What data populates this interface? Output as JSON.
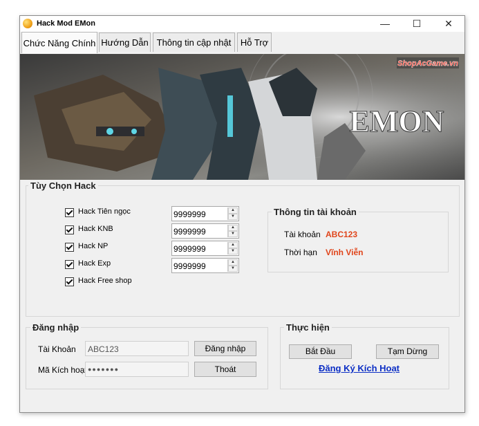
{
  "window": {
    "title": "Hack Mod EMon",
    "minimize": "—",
    "maximize": "☐",
    "close": "✕"
  },
  "tabs": [
    {
      "label": "Chức Năng Chính"
    },
    {
      "label": "Hướng Dẫn"
    },
    {
      "label": "Thông tin cập nhật"
    },
    {
      "label": "Hỗ Trợ"
    }
  ],
  "banner": {
    "watermark": "ShopAcGame.vn",
    "logo_text": "EMON"
  },
  "hack_options": {
    "title": "Tùy Chọn Hack",
    "items": [
      {
        "label": "Hack Tiên ngọc",
        "checked": true,
        "value": "9999999"
      },
      {
        "label": "Hack KNB",
        "checked": true,
        "value": "9999999"
      },
      {
        "label": "Hack NP",
        "checked": true,
        "value": "9999999"
      },
      {
        "label": "Hack Exp",
        "checked": true,
        "value": "9999999"
      },
      {
        "label": "Hack Free shop",
        "checked": true
      }
    ]
  },
  "account_info": {
    "title": "Thông tin tài khoản",
    "account_label": "Tài khoản",
    "account_value": "ABC123",
    "duration_label": "Thời hạn",
    "duration_value": "Vĩnh Viễn"
  },
  "login": {
    "title": "Đăng nhập",
    "account_label": "Tài Khoản",
    "account_value": "ABC123",
    "code_label": "Mã Kích hoạt",
    "code_value": "●●●●●●●",
    "login_button": "Đăng nhập",
    "exit_button": "Thoát"
  },
  "execute": {
    "title": "Thực hiện",
    "start_button": "Bắt Đầu",
    "pause_button": "Tạm Dừng",
    "register_link": "Đăng Ký Kích Hoạt"
  },
  "colors": {
    "accent_red": "#e0451b",
    "link_blue": "#0b2ec5"
  }
}
